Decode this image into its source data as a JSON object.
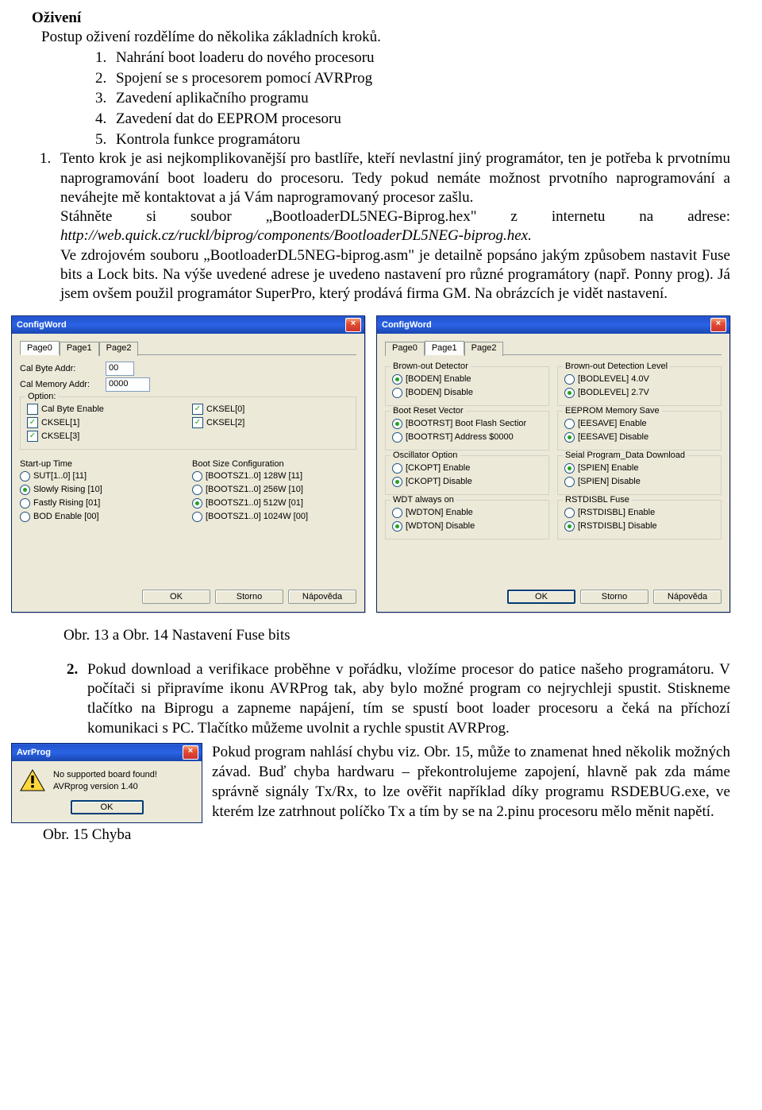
{
  "doc": {
    "heading": "Oživení",
    "intro": "Postup oživení rozdělíme do několika základních kroků.",
    "steps": [
      "Nahrání boot loaderu do nového procesoru",
      "Spojení se s procesorem pomocí AVRProg",
      "Zavedení aplikačního programu",
      "Zavedení dat do EEPROM procesoru",
      "Kontrola funkce programátoru"
    ],
    "body1_num": "1.",
    "body1": "Tento krok je asi nejkomplikovanější pro bastlíře, kteří nevlastní jiný programátor, ten je potřeba k prvotnímu naprogramování boot loaderu do procesoru. Tedy pokud nemáte možnost prvotního naprogramování a neváhejte mě kontaktovat a já Vám naprogramovaný procesor zašlu.",
    "body2a": "Stáhněte si soubor „BootloaderDL5NEG-Biprog.hex\" z internetu na adrese: ",
    "body2b": "http://web.quick.cz/ruckl/biprog/components/BootloaderDL5NEG-biprog.hex.",
    "body3": "Ve zdrojovém souboru  „BootloaderDL5NEG-biprog.asm\" je detailně popsáno jakým způsobem nastavit Fuse bits a Lock bits. Na výše uvedené adrese je uvedeno nastavení pro různé programátory (např. Ponny prog). Já jsem ovšem použil programátor SuperPro, který prodává firma GM. Na obrázcích je vidět nastavení.",
    "caption1": "Obr. 13 a Obr. 14 Nastavení Fuse bits",
    "bottom_num": "2.",
    "bottom_text": "Pokud download a verifikace proběhne v pořádku, vložíme procesor do patice našeho programátoru. V počítači si připravíme ikonu AVRProg tak, aby bylo možné program co nejrychleji spustit. Stiskneme tlačítko na Biprogu a zapneme napájení, tím se spustí boot loader procesoru a čeká na příchozí komunikaci s PC. Tlačítko můžeme uvolnit a rychle spustit AVRProg.",
    "right_text": "Pokud program nahlásí chybu viz. Obr. 15, může to znamenat hned několik možných závad. Buď chyba hardwaru – překontrolujeme zapojení, hlavně pak zda máme správně signály Tx/Rx, to lze ověřit například díky programu RSDEBUG.exe, ve kterém lze zatrhnout políčko Tx a tím by se na 2.pinu procesoru mělo měnit napětí.",
    "caption2": "Obr. 15 Chyba"
  },
  "dialogA": {
    "title": "ConfigWord",
    "tabs": [
      "Page0",
      "Page1",
      "Page2"
    ],
    "active_tab": 0,
    "cal_byte_label": "Cal Byte Addr:",
    "cal_byte_val": "00",
    "cal_mem_label": "Cal Memory Addr:",
    "cal_mem_val": "0000",
    "option_legend": "Option:",
    "opts_left": [
      {
        "label": "Cal Byte Enable",
        "checked": false
      },
      {
        "label": "CKSEL[1]",
        "checked": true
      },
      {
        "label": "CKSEL[3]",
        "checked": true
      }
    ],
    "opts_right": [
      {
        "label": "CKSEL[0]",
        "checked": true
      },
      {
        "label": "CKSEL[2]",
        "checked": true
      }
    ],
    "startup_label": "Start-up Time",
    "startup": [
      {
        "label": "SUT[1..0]   [11]",
        "on": false
      },
      {
        "label": "Slowly Rising [10]",
        "on": true
      },
      {
        "label": "Fastly Rising [01]",
        "on": false
      },
      {
        "label": "BOD Enable   [00]",
        "on": false
      }
    ],
    "boot_label": "Boot Size Configuration",
    "boot": [
      {
        "label": "[BOOTSZ1..0] 128W [11]",
        "on": false
      },
      {
        "label": "[BOOTSZ1..0] 256W [10]",
        "on": false
      },
      {
        "label": "[BOOTSZ1..0] 512W [01]",
        "on": true
      },
      {
        "label": "[BOOTSZ1..0] 1024W [00]",
        "on": false
      }
    ],
    "btn_ok": "OK",
    "btn_cancel": "Storno",
    "btn_help": "Nápověda"
  },
  "dialogB": {
    "title": "ConfigWord",
    "tabs": [
      "Page0",
      "Page1",
      "Page2"
    ],
    "active_tab": 1,
    "groups": [
      {
        "legend": "Brown-out Detector",
        "items": [
          {
            "label": "[BODEN] Enable",
            "on": true
          },
          {
            "label": "[BODEN] Disable",
            "on": false
          }
        ]
      },
      {
        "legend": "Brown-out Detection Level",
        "items": [
          {
            "label": "[BODLEVEL] 4.0V",
            "on": false
          },
          {
            "label": "[BODLEVEL] 2.7V",
            "on": true
          }
        ]
      },
      {
        "legend": "Boot Reset Vector",
        "items": [
          {
            "label": "[BOOTRST] Boot Flash Sectior",
            "on": true
          },
          {
            "label": "[BOOTRST] Address $0000",
            "on": false
          }
        ]
      },
      {
        "legend": "EEPROM Memory Save",
        "items": [
          {
            "label": "[EESAVE] Enable",
            "on": false
          },
          {
            "label": "[EESAVE] Disable",
            "on": true
          }
        ]
      },
      {
        "legend": "Oscillator Option",
        "items": [
          {
            "label": "[CKOPT] Enable",
            "on": false
          },
          {
            "label": "[CKOPT] Disable",
            "on": true
          }
        ]
      },
      {
        "legend": "Seial Program_Data Download",
        "items": [
          {
            "label": "[SPIEN] Enable",
            "on": true
          },
          {
            "label": "[SPIEN] Disable",
            "on": false
          }
        ]
      },
      {
        "legend": "WDT always on",
        "items": [
          {
            "label": "[WDTON] Enable",
            "on": false
          },
          {
            "label": "[WDTON] Disable",
            "on": true
          }
        ]
      },
      {
        "legend": "RSTDISBL Fuse",
        "items": [
          {
            "label": "[RSTDISBL] Enable",
            "on": false
          },
          {
            "label": "[RSTDISBL] Disable",
            "on": true
          }
        ]
      }
    ],
    "btn_ok": "OK",
    "btn_cancel": "Storno",
    "btn_help": "Nápověda"
  },
  "avrprog": {
    "title": "AvrProg",
    "msg1": "No supported board found!",
    "msg2": "AVRprog version 1.40",
    "btn_ok": "OK"
  }
}
